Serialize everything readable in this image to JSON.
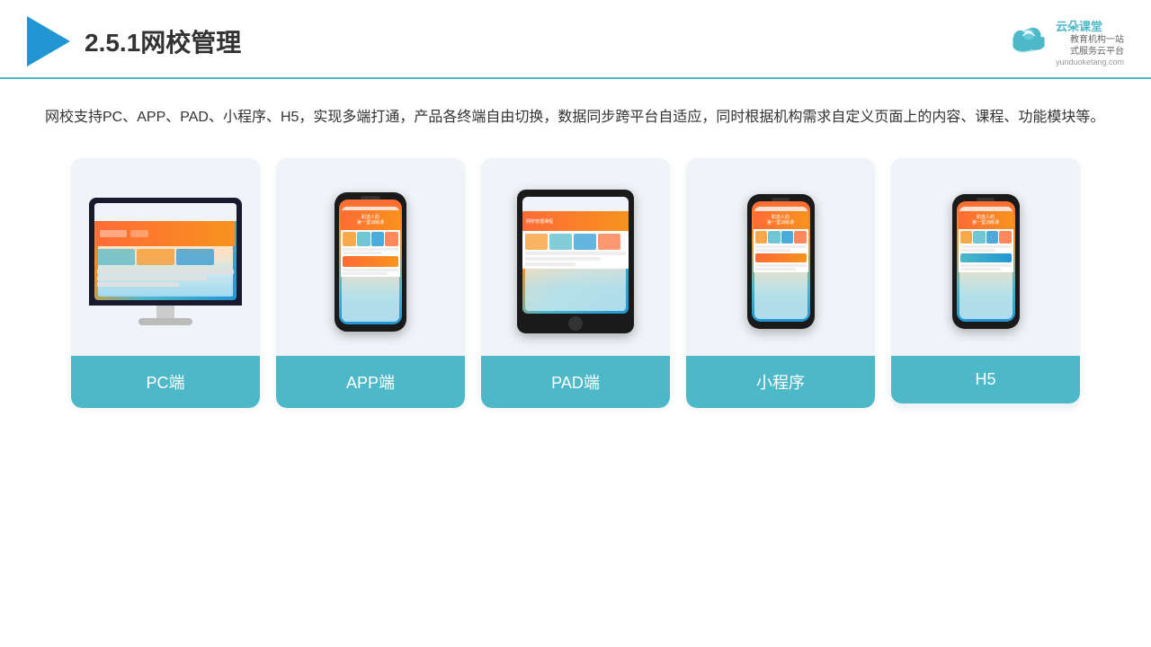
{
  "header": {
    "title": "2.5.1网校管理",
    "brand": {
      "name": "云朵课堂",
      "tagline": "教育机构一站\n式服务云平台",
      "url": "yunduoketang.com"
    }
  },
  "description": "网校支持PC、APP、PAD、小程序、H5，实现多端打通，产品各终端自由切换，数据同步跨平台自适应，同时根据机构需求自定义页面上的内容、课程、功能模块等。",
  "cards": [
    {
      "id": "pc",
      "label": "PC端"
    },
    {
      "id": "app",
      "label": "APP端"
    },
    {
      "id": "pad",
      "label": "PAD端"
    },
    {
      "id": "miniprogram",
      "label": "小程序"
    },
    {
      "id": "h5",
      "label": "H5"
    }
  ]
}
